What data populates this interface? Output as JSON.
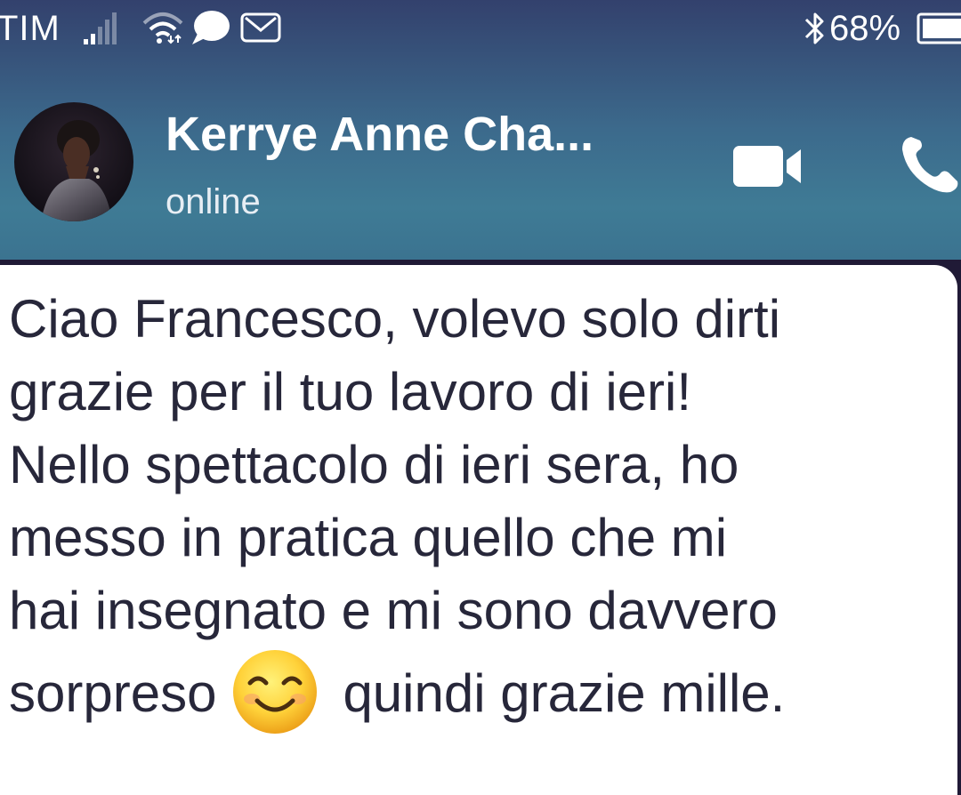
{
  "status_bar": {
    "carrier": "TIM",
    "battery_percent": "68%",
    "icons": [
      "signal-icon",
      "wifi-icon",
      "chat-bubble-icon",
      "gmail-icon",
      "bluetooth-icon",
      "battery-icon"
    ]
  },
  "header": {
    "contact_name": "Kerrye Anne Cha...",
    "contact_status": "online",
    "actions": [
      "video-call-icon",
      "voice-call-icon"
    ]
  },
  "message": {
    "before_emoji": "Ciao Francesco, volevo solo dirti\ngrazie per il tuo lavoro di ieri!\nNello spettacolo di ieri sera, ho\nmesso in pratica quello che mi\nhai insegnato e mi sono davvero\nsorpreso",
    "emoji": "smiling-face-with-smiling-eyes",
    "after_emoji": "quindi grazie mille."
  },
  "colors": {
    "header_top": "#33416d",
    "header_bottom": "#3f7b95",
    "bubble": "#ffffff",
    "message_text": "#27273a"
  }
}
